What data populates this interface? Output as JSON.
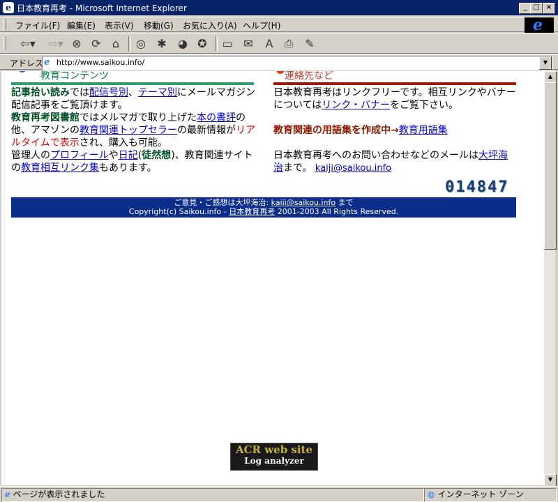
{
  "window": {
    "title": "日本教育再考 - Microsoft Internet Explorer",
    "btn_min": "_",
    "btn_max": "□",
    "btn_close": "×"
  },
  "menu": {
    "items": [
      "ファイル(F)",
      "編集(E)",
      "表示(V)",
      "移動(G)",
      "お気に入り(A)",
      "ヘルプ(H)"
    ]
  },
  "toolbar": {
    "icons": [
      "back-icon",
      "forward-icon",
      "stop-icon",
      "refresh-icon",
      "home-icon",
      "search-icon",
      "favorites-icon",
      "history-icon",
      "channels-icon",
      "fullscreen-icon",
      "mail-icon",
      "font-icon",
      "print-icon",
      "edit-icon"
    ]
  },
  "address": {
    "label": "アドレス",
    "url": "http://www.saikou.info/"
  },
  "page": {
    "left_header": "教育コンテンツ",
    "right_header": "連絡先など",
    "left": {
      "mag_strong": "記事拾い読み",
      "mag_t1": "では",
      "mag_link1": "配信号別",
      "mag_t2": "、",
      "mag_link2": "テーマ別",
      "mag_t3": "にメールマガジン配信記事をご覧頂けます。",
      "lib_strong": "教育再考図書館",
      "lib_t1": "ではメルマガで取り上げた",
      "lib_link1": "本の書評",
      "lib_t2": "の他、アマゾンの",
      "lib_link2": "教育関連トップセラー",
      "lib_t3": "の最新情報が",
      "lib_red": "リアルタイムで表示",
      "lib_t4": "され、購入も可能。",
      "adm_t1": "管理人の",
      "adm_link1": "プロフィール",
      "adm_t2": "や",
      "adm_link2": "日記",
      "adm_t3": "(",
      "adm_strong": "徒然想",
      "adm_t4": ")、教育関連サイトの",
      "adm_link3": "教育相互リンク集",
      "adm_t5": "もあります。"
    },
    "right": {
      "link_t1": "日本教育再考はリンクフリーです。相互リンクやバナーについては",
      "link_link": "リンク・バナー",
      "link_t2": "をご覧下さい。",
      "glossary_strong": "教育関連の用語集を作成中→",
      "glossary_link": "教育用語集",
      "contact_t1": "日本教育再考へのお問い合わせなどのメールは",
      "contact_link1": "大坪海治",
      "contact_t2": "まで。",
      "contact_link2": "kaiji@saikou.info"
    },
    "counter": "014847",
    "footer": {
      "l1_t1": "ご意見・ご感想は大坪海治: ",
      "l1_link": "kaiji@saikou.info",
      "l1_t2": " まで",
      "l2_t1": "Copyright(c) Saikou.info - ",
      "l2_link": "日本教育再考",
      "l2_t2": " 2001-2003 All Rights Reserved."
    },
    "acr_l1": "ACR web site",
    "acr_l2": "Log analyzer"
  },
  "status": {
    "text": "ページが表示されました",
    "zone": "インターネット ゾーン"
  }
}
